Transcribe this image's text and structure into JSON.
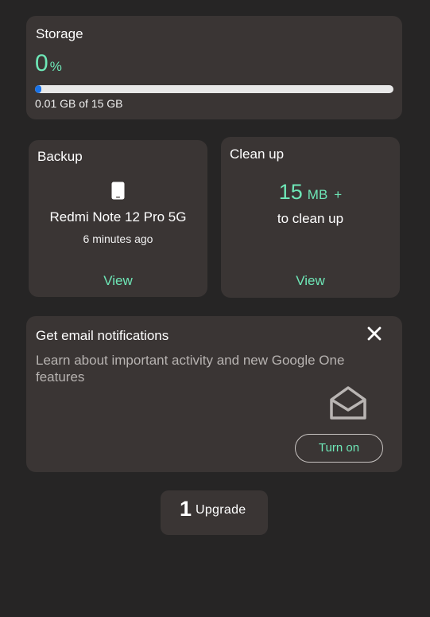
{
  "storage": {
    "title": "Storage",
    "percent_value": "0",
    "percent_unit": "%",
    "usage_fraction": 0.0007,
    "usage_text": "0.01 GB of 15 GB"
  },
  "backup": {
    "title": "Backup",
    "icon": "phone-icon",
    "device_name": "Redmi Note 12 Pro 5G",
    "time": "6 minutes ago",
    "view_label": "View"
  },
  "cleanup": {
    "title": "Clean up",
    "amount": "15",
    "unit": "MB",
    "plus": "+",
    "subtitle": "to clean up",
    "view_label": "View"
  },
  "email_notifications": {
    "title": "Get email notifications",
    "description": "Learn about important activity and new Google One features",
    "button_label": "Turn on",
    "icons": [
      "close-icon",
      "envelope-open-icon"
    ]
  },
  "upgrade": {
    "count": "1",
    "label": "Upgrade"
  },
  "colors": {
    "background": "#262525",
    "card": "#3a3534",
    "accent": "#6ee7b7",
    "progress": "#1a73e8"
  }
}
